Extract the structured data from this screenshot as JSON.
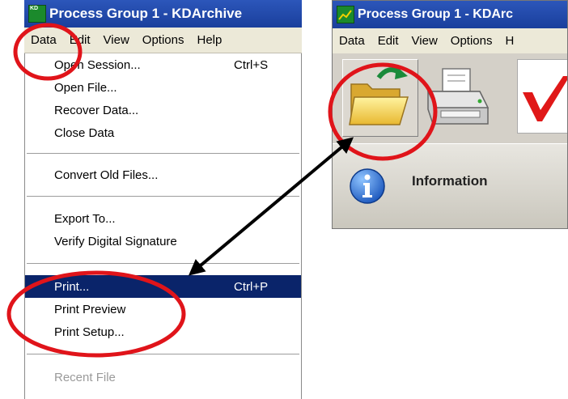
{
  "left_window": {
    "title": "Process Group 1 - KDArchive",
    "menubar": [
      "Data",
      "Edit",
      "View",
      "Options",
      "Help"
    ],
    "menu_items": [
      {
        "label": "Open Session...",
        "shortcut": "Ctrl+S"
      },
      {
        "label": "Open File...",
        "shortcut": ""
      },
      {
        "label": "Recover Data...",
        "shortcut": ""
      },
      {
        "label": "Close Data",
        "shortcut": ""
      },
      {
        "label": "Convert Old Files...",
        "shortcut": ""
      },
      {
        "label": "Export To...",
        "shortcut": ""
      },
      {
        "label": "Verify Digital Signature",
        "shortcut": ""
      },
      {
        "label": "Print...",
        "shortcut": "Ctrl+P"
      },
      {
        "label": "Print Preview",
        "shortcut": ""
      },
      {
        "label": "Print Setup...",
        "shortcut": ""
      },
      {
        "label": "Recent File",
        "shortcut": ""
      }
    ]
  },
  "right_window": {
    "title": "Process Group 1 - KDArc",
    "menubar": [
      "Data",
      "Edit",
      "View",
      "Options",
      "H"
    ],
    "info_label": "Information",
    "icon_kd": "KD"
  },
  "colors": {
    "titlebar": "#1a3f9c",
    "menu_highlight": "#0a246a",
    "annotation_red": "#e0141a",
    "annotation_arrow": "#000000"
  }
}
